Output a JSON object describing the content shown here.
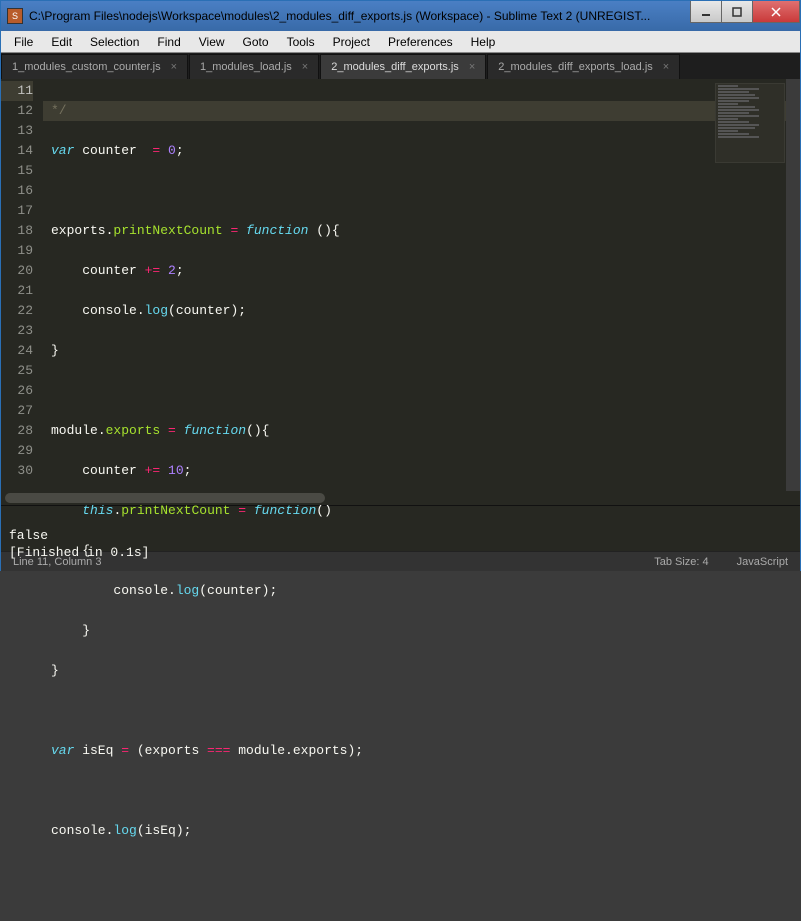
{
  "window": {
    "title": "C:\\Program Files\\nodejs\\Workspace\\modules\\2_modules_diff_exports.js (Workspace) - Sublime Text 2 (UNREGIST..."
  },
  "menu": {
    "items": [
      "File",
      "Edit",
      "Selection",
      "Find",
      "View",
      "Goto",
      "Tools",
      "Project",
      "Preferences",
      "Help"
    ]
  },
  "tabs": [
    {
      "label": "1_modules_custom_counter.js",
      "active": false
    },
    {
      "label": "1_modules_load.js",
      "active": false
    },
    {
      "label": "2_modules_diff_exports.js",
      "active": true
    },
    {
      "label": "2_modules_diff_exports_load.js",
      "active": false
    }
  ],
  "editor": {
    "first_line": 11,
    "selected_line": 11
  },
  "code": {
    "l11": "*/",
    "l12_var": "var",
    "l12_name": " counter  ",
    "l12_eq": "=",
    "l12_val": " 0",
    "l12_semi": ";",
    "l14_obj": "exports",
    "l14_dot": ".",
    "l14_prop": "printNextCount",
    "l14_eq": " = ",
    "l14_fn": "function",
    "l14_rest": " (){",
    "l15_body": "    counter ",
    "l15_op": "+=",
    "l15_sp": " ",
    "l15_num": "2",
    "l15_semi": ";",
    "l16_body": "    console.",
    "l16_fn": "log",
    "l16_rest": "(counter);",
    "l17": "}",
    "l19_obj": "module",
    "l19_dot": ".",
    "l19_prop": "exports",
    "l19_eq": " = ",
    "l19_fn": "function",
    "l19_rest": "(){",
    "l20_body": "    counter ",
    "l20_op": "+=",
    "l20_sp": " ",
    "l20_num": "10",
    "l20_semi": ";",
    "l21_body": "    ",
    "l21_this": "this",
    "l21_dot": ".",
    "l21_prop": "printNextCount",
    "l21_eq": " = ",
    "l21_fn": "function",
    "l21_rest": "()",
    "l22": "    {",
    "l23_body": "        console.",
    "l23_fn": "log",
    "l23_rest": "(counter);",
    "l24": "    }",
    "l25": "}",
    "l27_var": "var",
    "l27_name": " isEq ",
    "l27_eq": "=",
    "l27_p1": " (exports ",
    "l27_op": "===",
    "l27_p2": " module.exports);",
    "l29_body": "console.",
    "l29_fn": "log",
    "l29_rest": "(isEq);"
  },
  "console": {
    "line1": "false",
    "line2": "[Finished in 0.1s]"
  },
  "status": {
    "position": "Line 11, Column 3",
    "tab_size": "Tab Size: 4",
    "syntax": "JavaScript"
  }
}
